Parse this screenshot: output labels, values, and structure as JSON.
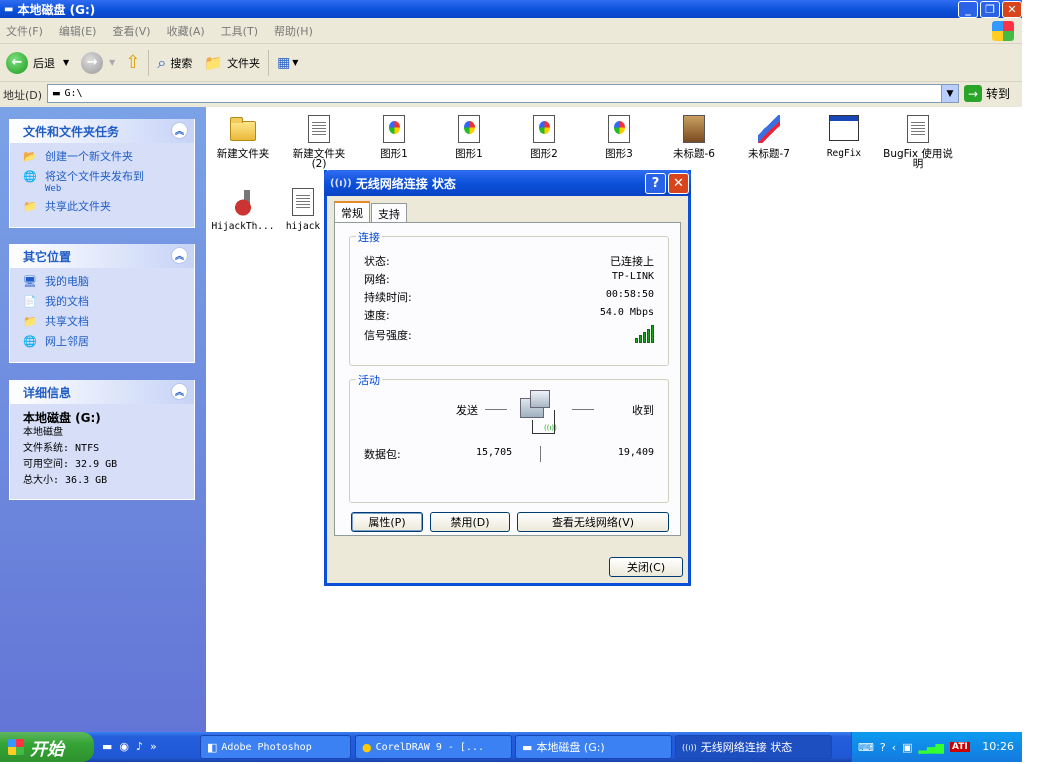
{
  "window": {
    "title": "本地磁盘 (G:)"
  },
  "menu": [
    "文件(F)",
    "编辑(E)",
    "查看(V)",
    "收藏(A)",
    "工具(T)",
    "帮助(H)"
  ],
  "toolbar": {
    "back_label": "后退",
    "search_label": "搜索",
    "folders_label": "文件夹"
  },
  "address": {
    "label": "地址(D)",
    "value": "G:\\",
    "go_label": "转到"
  },
  "tasks_panel": {
    "title": "文件和文件夹任务",
    "items": [
      {
        "label": "创建一个新文件夹"
      },
      {
        "label": "将这个文件夹发布到",
        "sub": "Web"
      },
      {
        "label": "共享此文件夹"
      }
    ]
  },
  "places_panel": {
    "title": "其它位置",
    "items": [
      {
        "label": "我的电脑"
      },
      {
        "label": "我的文档"
      },
      {
        "label": "共享文档"
      },
      {
        "label": "网上邻居"
      }
    ]
  },
  "details_panel": {
    "title": "详细信息",
    "name": "本地磁盘 (G:)",
    "type": "本地磁盘",
    "filesystem": "文件系统: NTFS",
    "free": "可用空间: 32.9 GB",
    "total": "总大小: 36.3 GB"
  },
  "files": [
    {
      "name": "新建文件夹",
      "icon": "folder-icon"
    },
    {
      "name": "新建文件夹 (2)",
      "icon": "folder-icon"
    },
    {
      "name": "图形1",
      "icon": "coreldraw-file-icon"
    },
    {
      "name": "图形1",
      "icon": "coreldraw-file-icon"
    },
    {
      "name": "图形2",
      "icon": "coreldraw-file-icon"
    },
    {
      "name": "图形3",
      "icon": "coreldraw-file-icon"
    },
    {
      "name": "未标题-6",
      "icon": "photoshop-file-icon"
    },
    {
      "name": "未标题-7",
      "icon": "photoshop-file-icon"
    },
    {
      "name": "RegFix",
      "icon": "regfix-window-icon"
    },
    {
      "name": "BugFix 使用说明",
      "icon": "text-doc-icon"
    },
    {
      "name": "HijackTh...",
      "icon": "hijackthis-icon"
    },
    {
      "name": "hijack",
      "icon": "text-doc-icon"
    }
  ],
  "dialog": {
    "title": "无线网络连接 状态",
    "help_btn": "?",
    "close_btn": "✕",
    "tabs": [
      "常规",
      "支持"
    ],
    "connection": {
      "label": "连接",
      "rows": [
        {
          "k": "状态:",
          "v": "已连接上"
        },
        {
          "k": "网络:",
          "v": "TP-LINK"
        },
        {
          "k": "持续时间:",
          "v": "00:58:50"
        },
        {
          "k": "速度:",
          "v": "54.0 Mbps"
        }
      ],
      "signal_label": "信号强度:",
      "signal_level": 5
    },
    "activity": {
      "label": "活动",
      "sent_label": "发送",
      "received_label": "收到",
      "packets_label": "数据包:",
      "packets_sent": "15,705",
      "packets_received": "19,409"
    },
    "buttons": {
      "properties": "属性(P)",
      "disable": "禁用(D)",
      "view_networks": "查看无线网络(V)",
      "close": "关闭(C)"
    }
  },
  "taskbar": {
    "start": "开始",
    "tasks": [
      {
        "label": "Adobe Photoshop"
      },
      {
        "label": "CorelDRAW 9 - [..."
      },
      {
        "label": "本地磁盘 (G:)"
      },
      {
        "label": "无线网络连接 状态"
      }
    ],
    "clock": "10:26",
    "tray_ati": "ATI"
  }
}
